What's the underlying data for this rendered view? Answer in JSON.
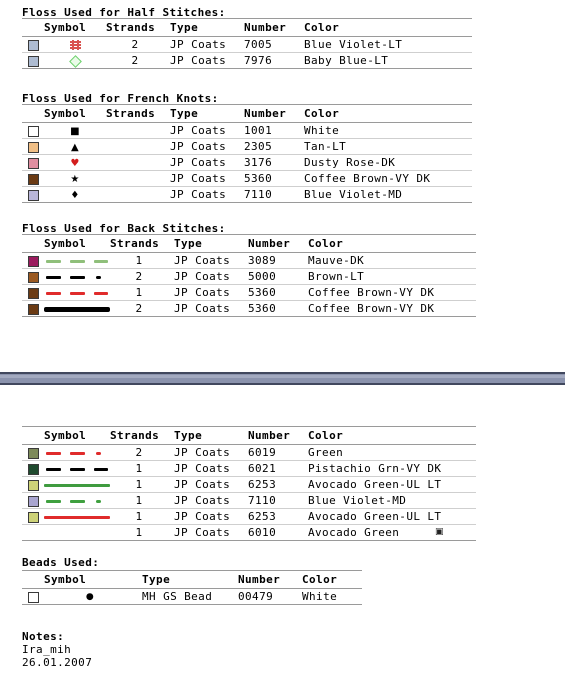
{
  "document": {
    "columns_main": [
      "Symbol",
      "Strands",
      "Type",
      "Number",
      "Color"
    ],
    "columns_beads": [
      "Symbol",
      "Type",
      "Number",
      "Color"
    ]
  },
  "sections": {
    "half_stitches": {
      "title": "Floss Used for Half Stitches:",
      "headers": {
        "symbol": "Symbol",
        "strands": "Strands",
        "type": "Type",
        "number": "Number",
        "color": "Color"
      },
      "rows": [
        {
          "swatch": "#aebcd2",
          "symbol_kind": "hatch",
          "symbol_color": "#d9534f",
          "strands": "2",
          "type": "JP Coats",
          "number": "7005",
          "color": "Blue Violet-LT"
        },
        {
          "swatch": "#aebcd2",
          "symbol_kind": "diamond",
          "symbol_color": "#6ad06a",
          "strands": "2",
          "type": "JP Coats",
          "number": "7976",
          "color": "Baby Blue-LT"
        }
      ]
    },
    "french_knots": {
      "title": "Floss Used for French Knots:",
      "headers": {
        "symbol": "Symbol",
        "strands": "Strands",
        "type": "Type",
        "number": "Number",
        "color": "Color"
      },
      "rows": [
        {
          "swatch": "#ffffff",
          "symbol_kind": "glyph",
          "symbol_char": "■",
          "symbol_color": "#000000",
          "strands": "",
          "type": "JP Coats",
          "number": "1001",
          "color": "White"
        },
        {
          "swatch": "#f0bf86",
          "symbol_kind": "glyph",
          "symbol_char": "▲",
          "symbol_color": "#000000",
          "strands": "",
          "type": "JP Coats",
          "number": "2305",
          "color": "Tan-LT"
        },
        {
          "swatch": "#e08ea0",
          "symbol_kind": "glyph",
          "symbol_char": "♥",
          "symbol_color": "#d31d1d",
          "strands": "",
          "type": "JP Coats",
          "number": "3176",
          "color": "Dusty Rose-DK"
        },
        {
          "swatch": "#6b3b14",
          "symbol_kind": "glyph",
          "symbol_char": "★",
          "symbol_color": "#000000",
          "strands": "",
          "type": "JP Coats",
          "number": "5360",
          "color": "Coffee Brown-VY DK"
        },
        {
          "swatch": "#b9b6d8",
          "symbol_kind": "glyph",
          "symbol_char": "♦",
          "symbol_color": "#000000",
          "strands": "",
          "type": "JP Coats",
          "number": "7110",
          "color": "Blue Violet-MD"
        }
      ]
    },
    "back_stitches": {
      "title": "Floss Used for Back Stitches:",
      "headers": {
        "symbol": "Symbol",
        "strands": "Strands",
        "type": "Type",
        "number": "Number",
        "color": "Color"
      },
      "rows": [
        {
          "swatch": "#9b1b5e",
          "line_style": "dash3",
          "line_color": "#8fbf7a",
          "strands": "1",
          "type": "JP Coats",
          "number": "3089",
          "color": "Mauve-DK"
        },
        {
          "swatch": "#9b5a22",
          "line_style": "dashdot",
          "line_color": "#000000",
          "strands": "2",
          "type": "JP Coats",
          "number": "5000",
          "color": "Brown-LT"
        },
        {
          "swatch": "#6b3b14",
          "line_style": "dash3",
          "line_color": "#e02b2b",
          "strands": "1",
          "type": "JP Coats",
          "number": "5360",
          "color": "Coffee Brown-VY DK"
        },
        {
          "swatch": "#6b3b14",
          "line_style": "thick",
          "line_color": "#000000",
          "strands": "2",
          "type": "JP Coats",
          "number": "5360",
          "color": "Coffee Brown-VY DK"
        }
      ]
    },
    "back_stitches_continued": {
      "headers": {
        "symbol": "Symbol",
        "strands": "Strands",
        "type": "Type",
        "number": "Number",
        "color": "Color"
      },
      "rows": [
        {
          "swatch": "#7d8a5a",
          "line_style": "dashdot",
          "line_color": "#e02b2b",
          "strands": "2",
          "type": "JP Coats",
          "number": "6019",
          "color": "Green"
        },
        {
          "swatch": "#1f4a2e",
          "line_style": "dash3",
          "line_color": "#000000",
          "strands": "1",
          "type": "JP Coats",
          "number": "6021",
          "color": "Pistachio Grn-VY DK"
        },
        {
          "swatch": "#cdd278",
          "line_style": "solid",
          "line_color": "#3f9b3f",
          "strands": "1",
          "type": "JP Coats",
          "number": "6253",
          "color": "Avocado Green-UL LT"
        },
        {
          "swatch": "#a9a5d0",
          "line_style": "dashdot",
          "line_color": "#3fa03f",
          "strands": "1",
          "type": "JP Coats",
          "number": "7110",
          "color": "Blue Violet-MD"
        },
        {
          "swatch": "#cdd278",
          "line_style": "solid",
          "line_color": "#e02b2b",
          "strands": "1",
          "type": "JP Coats",
          "number": "6253",
          "color": "Avocado Green-UL LT"
        },
        {
          "swatch": "",
          "line_style": "none",
          "line_color": "",
          "strands": "1",
          "type": "JP Coats",
          "number": "6010",
          "color": "Avocado Green"
        }
      ]
    },
    "beads": {
      "title": "Beads Used:",
      "headers": {
        "symbol": "Symbol",
        "type": "Type",
        "number": "Number",
        "color": "Color"
      },
      "rows": [
        {
          "swatch": "#ffffff",
          "symbol_char": "●",
          "symbol_color": "#000000",
          "type": "MH GS Bead",
          "number": "00479",
          "color": "White"
        }
      ]
    },
    "notes": {
      "title": "Notes:",
      "lines": [
        "Ira_mih",
        "26.01.2007"
      ]
    }
  },
  "stray_marker": {
    "char": "▣"
  }
}
